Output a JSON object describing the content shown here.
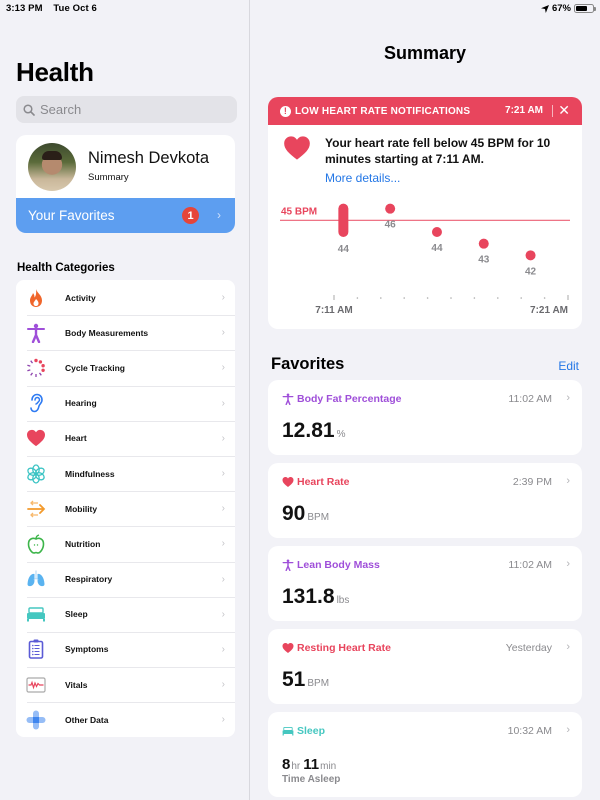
{
  "status_bar": {
    "time": "3:13 PM",
    "date": "Tue Oct 6",
    "battery": "67%",
    "battery_level": 0.67
  },
  "sidebar": {
    "title": "Health",
    "search": {
      "placeholder": "Search",
      "value": ""
    },
    "profile": {
      "name": "Nimesh Devkota",
      "subtitle": "Summary"
    },
    "favorites": {
      "label": "Your Favorites",
      "badge": "1"
    },
    "categories_title": "Health Categories",
    "categories": [
      {
        "label": "Activity",
        "icon": "flame-icon",
        "color": "#f0662b"
      },
      {
        "label": "Body Measurements",
        "icon": "figure-icon",
        "color": "#9f4fd9"
      },
      {
        "label": "Cycle Tracking",
        "icon": "cycle-dots-icon",
        "color": "#e8455d"
      },
      {
        "label": "Hearing",
        "icon": "ear-icon",
        "color": "#2f7bf2"
      },
      {
        "label": "Heart",
        "icon": "heart-icon",
        "color": "#e8455d"
      },
      {
        "label": "Mindfulness",
        "icon": "flower-icon",
        "color": "#3cc4c4"
      },
      {
        "label": "Mobility",
        "icon": "arrows-icon",
        "color": "#f39a2c"
      },
      {
        "label": "Nutrition",
        "icon": "apple-icon",
        "color": "#3db54a"
      },
      {
        "label": "Respiratory",
        "icon": "lungs-icon",
        "color": "#5ab3f0"
      },
      {
        "label": "Sleep",
        "icon": "bed-icon",
        "color": "#45c7c0"
      },
      {
        "label": "Symptoms",
        "icon": "clipboard-icon",
        "color": "#5b5bd6"
      },
      {
        "label": "Vitals",
        "icon": "vitals-icon",
        "color": "#e8455d"
      },
      {
        "label": "Other Data",
        "icon": "plus-icon",
        "color": "#3f86ef"
      }
    ]
  },
  "main": {
    "title": "Summary",
    "alert": {
      "header": "LOW HEART RATE NOTIFICATIONS",
      "time": "7:21 AM",
      "message": "Your heart rate fell below 45 BPM for 10 minutes starting at 7:11 AM.",
      "link": "More details..."
    },
    "favorites_title": "Favorites",
    "edit_label": "Edit",
    "favorites": [
      {
        "title": "Body Fat Percentage",
        "time": "11:02 AM",
        "value": "12.81",
        "unit": "%",
        "color": "#9f4fd9",
        "icon": "figure-icon"
      },
      {
        "title": "Heart Rate",
        "time": "2:39 PM",
        "value": "90",
        "unit": "BPM",
        "color": "#e8455d",
        "icon": "heart-icon"
      },
      {
        "title": "Lean Body Mass",
        "time": "11:02 AM",
        "value": "131.8",
        "unit": "lbs",
        "color": "#9f4fd9",
        "icon": "figure-icon"
      },
      {
        "title": "Resting Heart Rate",
        "time": "Yesterday",
        "value": "51",
        "unit": "BPM",
        "color": "#e8455d",
        "icon": "heart-icon"
      },
      {
        "title": "Sleep",
        "time": "10:32 AM",
        "hours": "8",
        "hours_unit": "hr",
        "minutes": "11",
        "minutes_unit": "min",
        "subtitle": "Time Asleep",
        "color": "#45c7c0",
        "icon": "bed-icon"
      }
    ]
  },
  "chart_data": {
    "type": "scatter",
    "title": "Low Heart Rate",
    "threshold": {
      "value": 45,
      "label": "45 BPM"
    },
    "x_labels": [
      "7:11 AM",
      "7:21 AM"
    ],
    "xlim": [
      "7:11 AM",
      "7:21 AM"
    ],
    "points": [
      {
        "x_minute": 0.4,
        "value": 44,
        "range": [
          44,
          46
        ],
        "label": "44"
      },
      {
        "x_minute": 2.4,
        "value": 46,
        "label": "46"
      },
      {
        "x_minute": 4.4,
        "value": 44,
        "label": "44"
      },
      {
        "x_minute": 6.4,
        "value": 43,
        "label": "43"
      },
      {
        "x_minute": 8.4,
        "value": 42,
        "label": "42"
      }
    ],
    "ylim": [
      41,
      47
    ],
    "color": "#e8455d"
  }
}
